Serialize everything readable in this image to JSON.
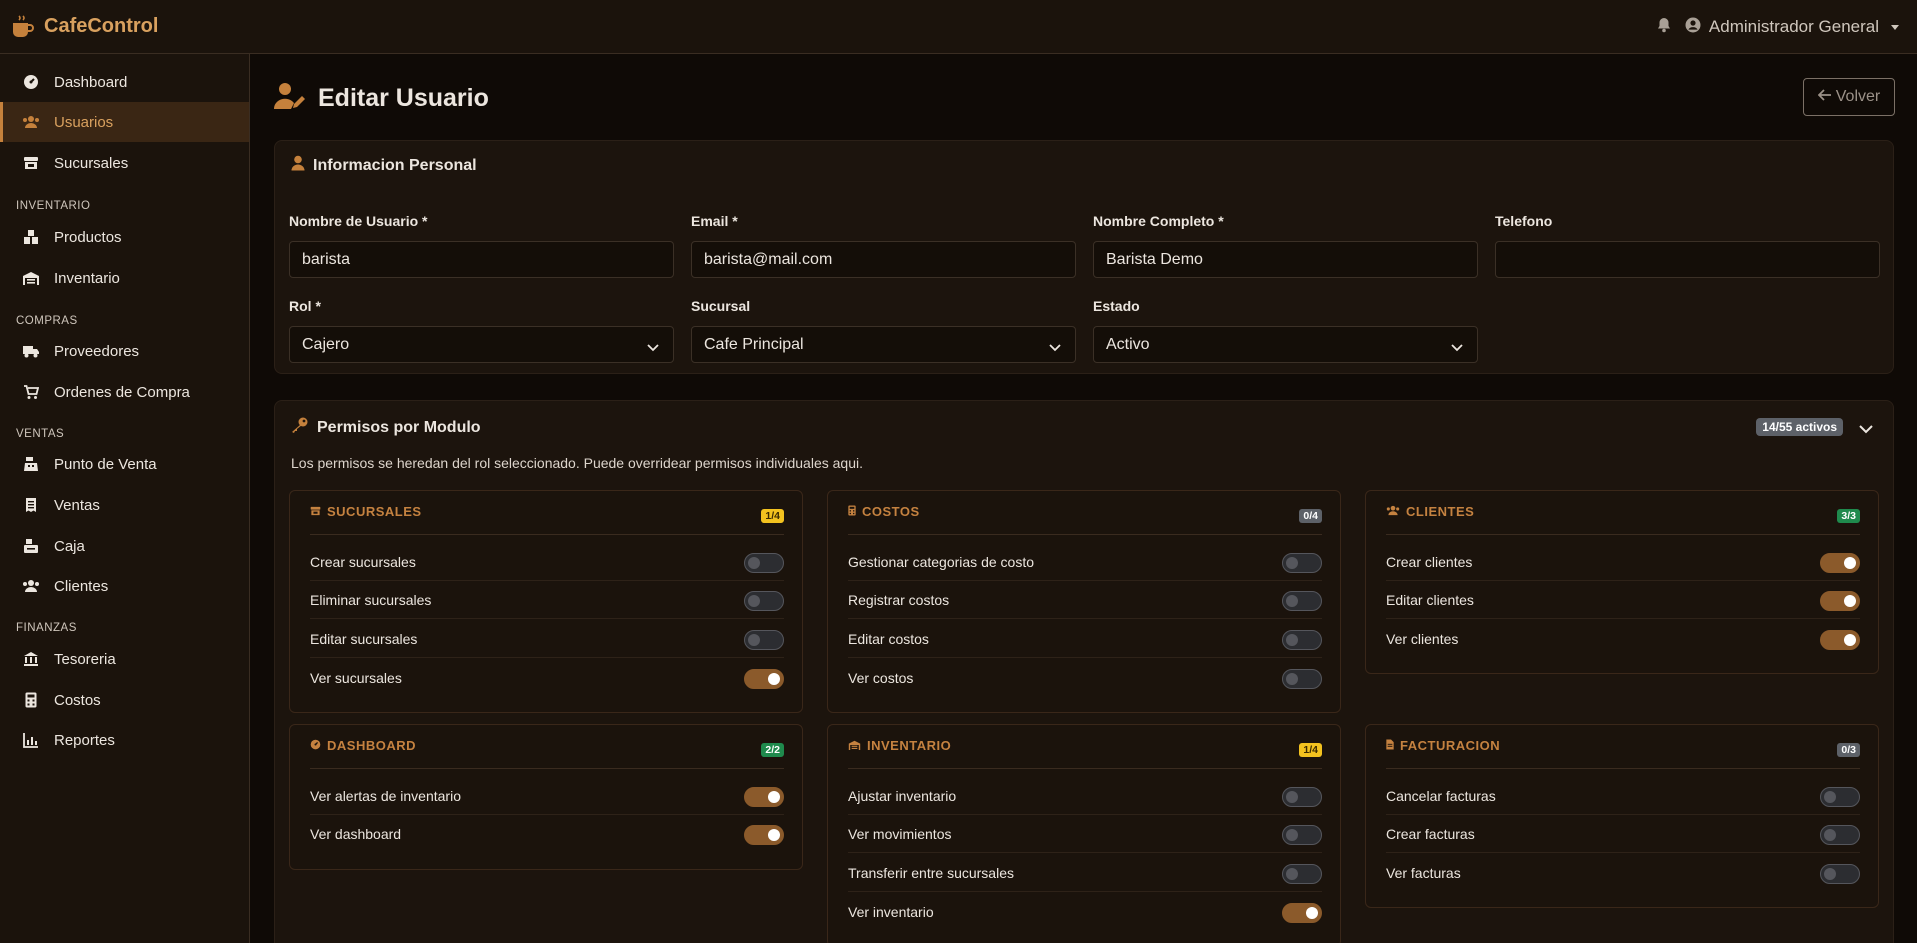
{
  "app": {
    "brand_name": "CafeControl",
    "user_name": "Administrador General"
  },
  "colors": {
    "accent": "#c5813c",
    "background": "#0f0a06",
    "panel": "#1c140d"
  },
  "sidebar": {
    "items": [
      {
        "label": "Dashboard",
        "icon": "gauge-icon"
      },
      {
        "label": "Usuarios",
        "icon": "users-icon",
        "active": true
      },
      {
        "label": "Sucursales",
        "icon": "store-icon"
      },
      {
        "label": "Productos",
        "icon": "boxes-icon"
      },
      {
        "label": "Inventario",
        "icon": "warehouse-icon"
      },
      {
        "label": "Proveedores",
        "icon": "truck-icon"
      },
      {
        "label": "Ordenes de Compra",
        "icon": "cart-icon"
      },
      {
        "label": "Punto de Venta",
        "icon": "cash-register-icon"
      },
      {
        "label": "Ventas",
        "icon": "receipt-icon"
      },
      {
        "label": "Caja",
        "icon": "cash-box-icon"
      },
      {
        "label": "Clientes",
        "icon": "clients-icon"
      },
      {
        "label": "Tesoreria",
        "icon": "bank-icon"
      },
      {
        "label": "Costos",
        "icon": "calculator-icon"
      },
      {
        "label": "Reportes",
        "icon": "chart-icon"
      }
    ],
    "sections": [
      "INVENTARIO",
      "COMPRAS",
      "VENTAS",
      "FINANZAS"
    ]
  },
  "page": {
    "title": "Editar Usuario",
    "back_label": "Volver"
  },
  "personal": {
    "title": "Informacion Personal",
    "fields": {
      "username": {
        "label": "Nombre de Usuario *",
        "value": "barista"
      },
      "email": {
        "label": "Email *",
        "value": "barista@mail.com"
      },
      "fullname": {
        "label": "Nombre Completo *",
        "value": "Barista Demo"
      },
      "phone": {
        "label": "Telefono",
        "value": ""
      },
      "role": {
        "label": "Rol *",
        "value": "Cajero"
      },
      "branch": {
        "label": "Sucursal",
        "value": "Cafe Principal"
      },
      "status": {
        "label": "Estado",
        "value": "Activo"
      }
    }
  },
  "permissions": {
    "title": "Permisos por Modulo",
    "count_badge": "14/55 activos",
    "description": "Los permisos se heredan del rol seleccionado. Puede overridear permisos individuales aqui.",
    "modules": [
      {
        "name": "SUCURSALES",
        "badge": "1/4",
        "icon": "store-icon",
        "items": [
          {
            "label": "Crear sucursales",
            "on": false
          },
          {
            "label": "Eliminar sucursales",
            "on": false
          },
          {
            "label": "Editar sucursales",
            "on": false
          },
          {
            "label": "Ver sucursales",
            "on": true
          }
        ]
      },
      {
        "name": "COSTOS",
        "badge": "0/4",
        "icon": "calculator-icon",
        "items": [
          {
            "label": "Gestionar categorias de costo",
            "on": false
          },
          {
            "label": "Registrar costos",
            "on": false
          },
          {
            "label": "Editar costos",
            "on": false
          },
          {
            "label": "Ver costos",
            "on": false
          }
        ]
      },
      {
        "name": "CLIENTES",
        "badge": "3/3",
        "icon": "clients-icon",
        "items": [
          {
            "label": "Crear clientes",
            "on": true
          },
          {
            "label": "Editar clientes",
            "on": true
          },
          {
            "label": "Ver clientes",
            "on": true
          }
        ]
      },
      {
        "name": "DASHBOARD",
        "badge": "2/2",
        "icon": "gauge-icon",
        "items": [
          {
            "label": "Ver alertas de inventario",
            "on": true
          },
          {
            "label": "Ver dashboard",
            "on": true
          }
        ]
      },
      {
        "name": "INVENTARIO",
        "badge": "1/4",
        "icon": "warehouse-icon",
        "items": [
          {
            "label": "Ajustar inventario",
            "on": false
          },
          {
            "label": "Ver movimientos",
            "on": false
          },
          {
            "label": "Transferir entre sucursales",
            "on": false
          },
          {
            "label": "Ver inventario",
            "on": true
          }
        ]
      },
      {
        "name": "FACTURACION",
        "badge": "0/3",
        "icon": "invoice-icon",
        "items": [
          {
            "label": "Cancelar facturas",
            "on": false
          },
          {
            "label": "Crear facturas",
            "on": false
          },
          {
            "label": "Ver facturas",
            "on": false
          }
        ]
      }
    ]
  }
}
